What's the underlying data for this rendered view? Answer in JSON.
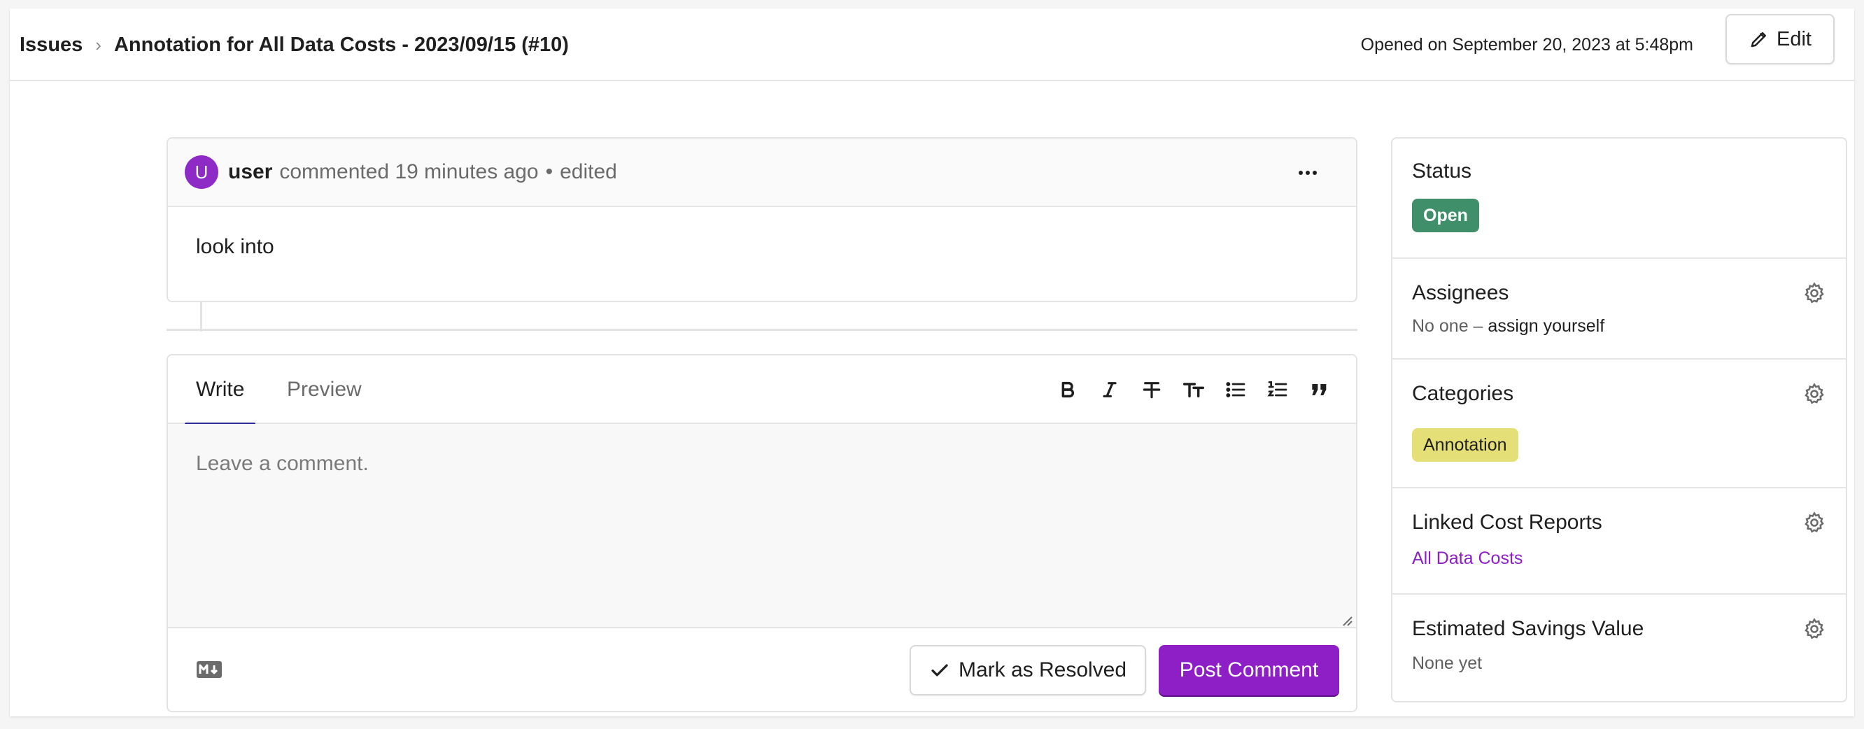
{
  "header": {
    "breadcrumb_root": "Issues",
    "breadcrumb_separator": "›",
    "title": "Annotation for All Data Costs - 2023/09/15 (#10)",
    "opened_on": "Opened on September 20, 2023 at 5:48pm",
    "edit_label": "Edit"
  },
  "comment": {
    "avatar_initial": "U",
    "user": "user",
    "meta": "commented 19 minutes ago",
    "dot": "•",
    "edited": "edited",
    "body": "look into"
  },
  "editor": {
    "tabs": [
      {
        "label": "Write",
        "active": true
      },
      {
        "label": "Preview",
        "active": false
      }
    ],
    "toolbar_icons": [
      "bold-icon",
      "italic-icon",
      "strikethrough-icon",
      "text-size-icon",
      "bullet-list-icon",
      "numbered-list-icon",
      "quote-icon"
    ],
    "placeholder": "Leave a comment.",
    "value": "",
    "resolve_label": "Mark as Resolved",
    "post_label": "Post Comment"
  },
  "sidebar": {
    "status": {
      "title": "Status",
      "badge": "Open",
      "badge_color": "#3e8f6a"
    },
    "assignees": {
      "title": "Assignees",
      "none_text": "No one –",
      "assign_text": "assign yourself"
    },
    "categories": {
      "title": "Categories",
      "badge": "Annotation",
      "badge_color": "#e4df76"
    },
    "linked": {
      "title": "Linked Cost Reports",
      "link": "All Data Costs"
    },
    "savings": {
      "title": "Estimated Savings Value",
      "value": "None yet"
    }
  },
  "colors": {
    "accent": "#8e1fc7",
    "tab_underline": "#2d2d9a"
  }
}
